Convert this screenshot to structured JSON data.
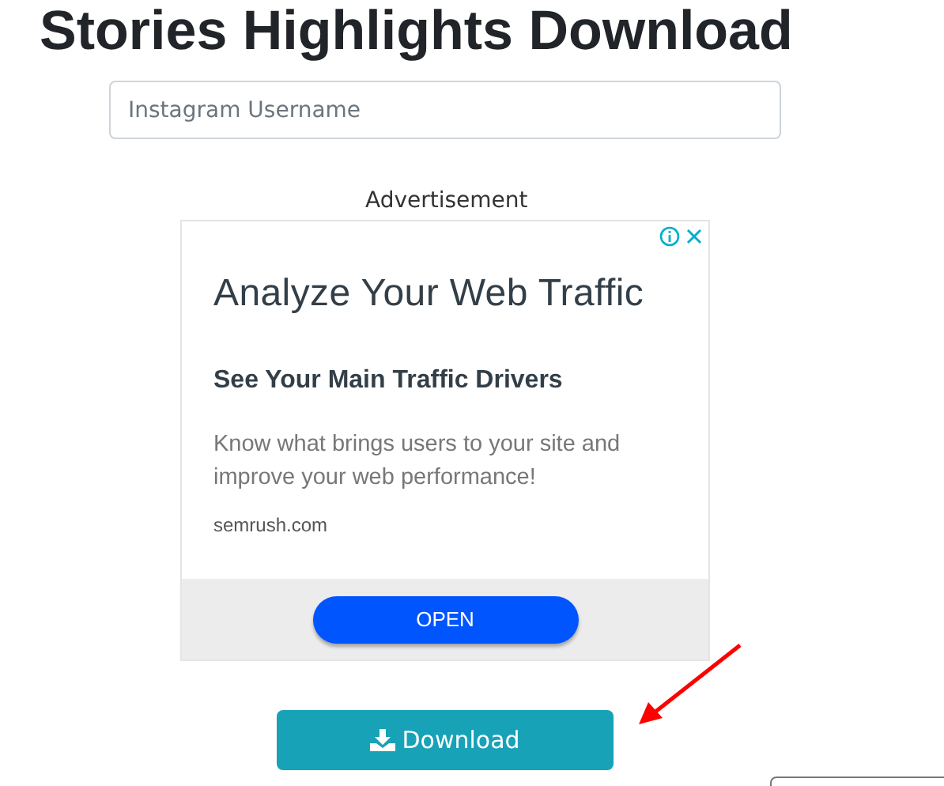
{
  "title": "Stories Highlights Download",
  "username_field": {
    "placeholder": "Instagram Username"
  },
  "ad_label": "Advertisement",
  "ad": {
    "headline": "Analyze Your Web Traffic",
    "subheadline": "See Your Main Traffic Drivers",
    "body": "Know what brings users to your site and improve your web performance!",
    "domain": "semrush.com",
    "button": "OPEN"
  },
  "download_button": "Download"
}
